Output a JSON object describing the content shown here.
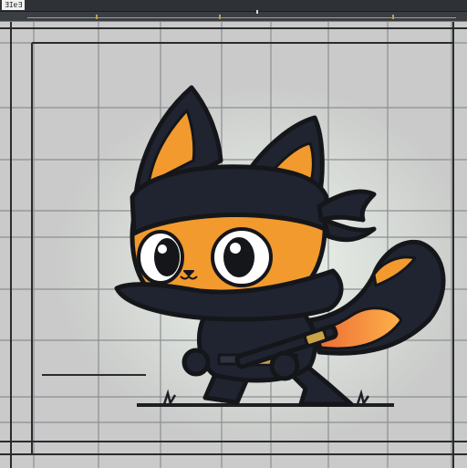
{
  "app": {
    "label": "ƎIɐƎ"
  },
  "sprite": {
    "name": "ninja-cat",
    "headband_color": "#1f2430",
    "fur_color": "#f29a2e"
  },
  "grid": {
    "visible": true
  },
  "colors": {
    "canvas_bg": "#c9cac9",
    "grid_line": "#8c8f93",
    "frame_line": "#2a2b2e",
    "glow": "#e6f1e6"
  }
}
